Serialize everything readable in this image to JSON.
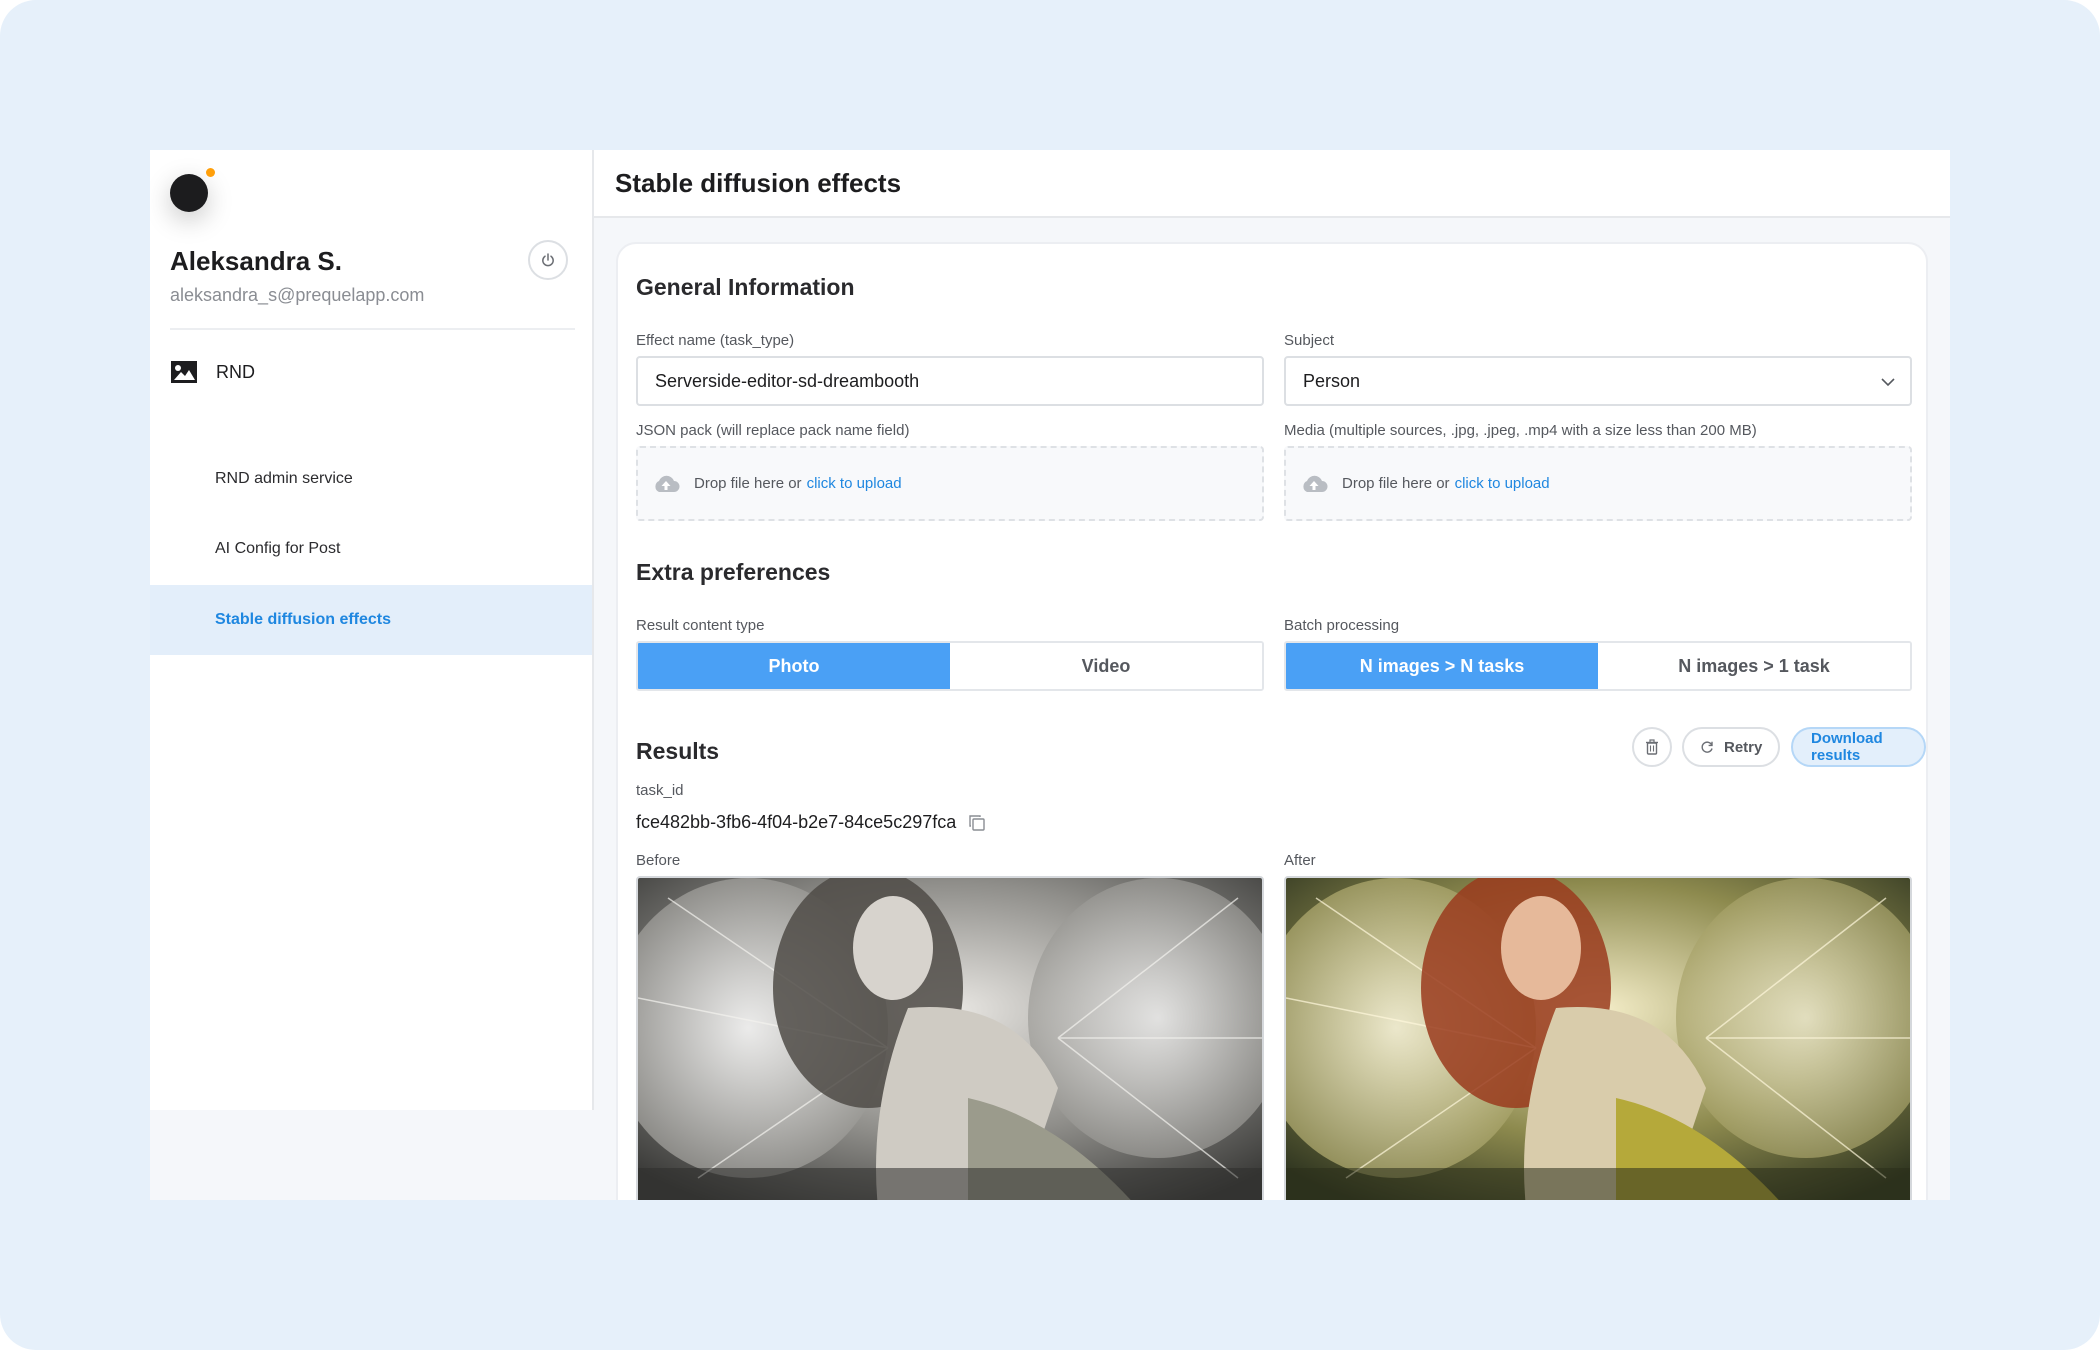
{
  "user": {
    "name": "Aleksandra S.",
    "email": "aleksandra_s@prequelapp.com"
  },
  "sidebar": {
    "group_label": "RND",
    "items": [
      {
        "label": "RND admin service",
        "active": false
      },
      {
        "label": "AI Config for Post",
        "active": false
      },
      {
        "label": "Stable diffusion effects",
        "active": true
      }
    ]
  },
  "page": {
    "title": "Stable diffusion effects"
  },
  "general": {
    "title": "General Information",
    "effect_name_label": "Effect name (task_type)",
    "effect_name_value": "Serverside-editor-sd-dreambooth",
    "subject_label": "Subject",
    "subject_value": "Person",
    "json_pack_label": "JSON pack (will replace pack name field)",
    "media_label": "Media (multiple sources, .jpg, .jpeg, .mp4 with a size less than 200 MB)",
    "drop_text": "Drop file here or",
    "upload_link": "click to upload"
  },
  "extra": {
    "title": "Extra preferences",
    "content_type_label": "Result content type",
    "content_type_options": [
      "Photo",
      "Video"
    ],
    "content_type_selected": "Photo",
    "batch_label": "Batch processing",
    "batch_options": [
      "N images > N tasks",
      "N images > 1 task"
    ],
    "batch_selected": "N images > N tasks"
  },
  "results": {
    "title": "Results",
    "retry_label": "Retry",
    "download_label": "Download results",
    "task_id_label": "task_id",
    "task_id_value": "fce482bb-3fb6-4f04-b2e7-84ce5c297fca",
    "before_label": "Before",
    "after_label": "After"
  },
  "colors": {
    "accent": "#4aa0f5",
    "link": "#1f87e0",
    "active_nav_bg": "#e3eefa",
    "status_dot": "#ff9f0a",
    "frame_bg": "#e6f0fa"
  },
  "icons": [
    "power-icon",
    "image-icon",
    "cloud-upload-icon",
    "chevron-down-icon",
    "trash-icon",
    "refresh-icon",
    "copy-icon"
  ]
}
